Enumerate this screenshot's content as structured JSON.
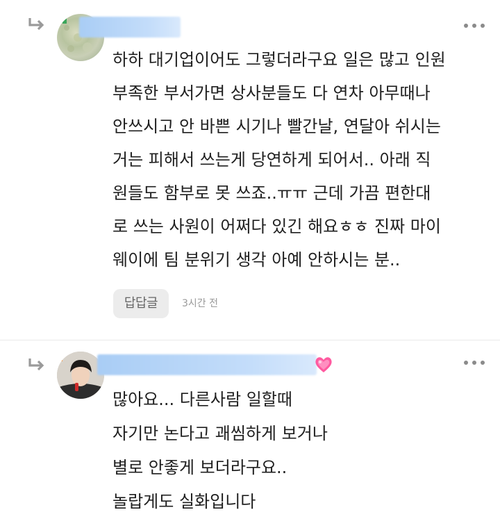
{
  "comments": [
    {
      "lines": [
        "하하 대기업이어도 그렇더라구요 일은 많고 인원",
        "부족한 부서가면 상사분들도 다 연차 아무때나",
        "안쓰시고 안 바쁜 시기나 빨간날, 연달아 쉬시는",
        "거는 피해서 쓰는게 당연하게 되어서.. 아래 직",
        "원들도 함부로 못 쓰죠..ㅠㅠ 근데 가끔 편한대",
        "로 쓰는 사원이 어쩌다 있긴 해요ㅎㅎ 진짜 마이",
        "웨이에 팀 분위기 생각 아예 안하시는 분.."
      ],
      "reply_button": "답답글",
      "time": "3시간 전",
      "more_icon": "more-dots-icon",
      "reply_icon": "reply-arrow-icon"
    },
    {
      "lines": [
        "많아요... 다른사람 일할때",
        "자기만 논다고 괘씸하게 보거나",
        "별로 안좋게 보더라구요..",
        "놀랍게도 실화입니다"
      ],
      "more_icon": "more-dots-icon",
      "reply_icon": "reply-arrow-icon",
      "nickname_emoji": "heart-icon"
    }
  ],
  "colors": {
    "text": "#1f1f1f",
    "meta": "#9a9a9a",
    "reply_button_bg": "#ececec",
    "nickname_mask": "#a9cdf5",
    "heart": "#ff5aa0"
  }
}
